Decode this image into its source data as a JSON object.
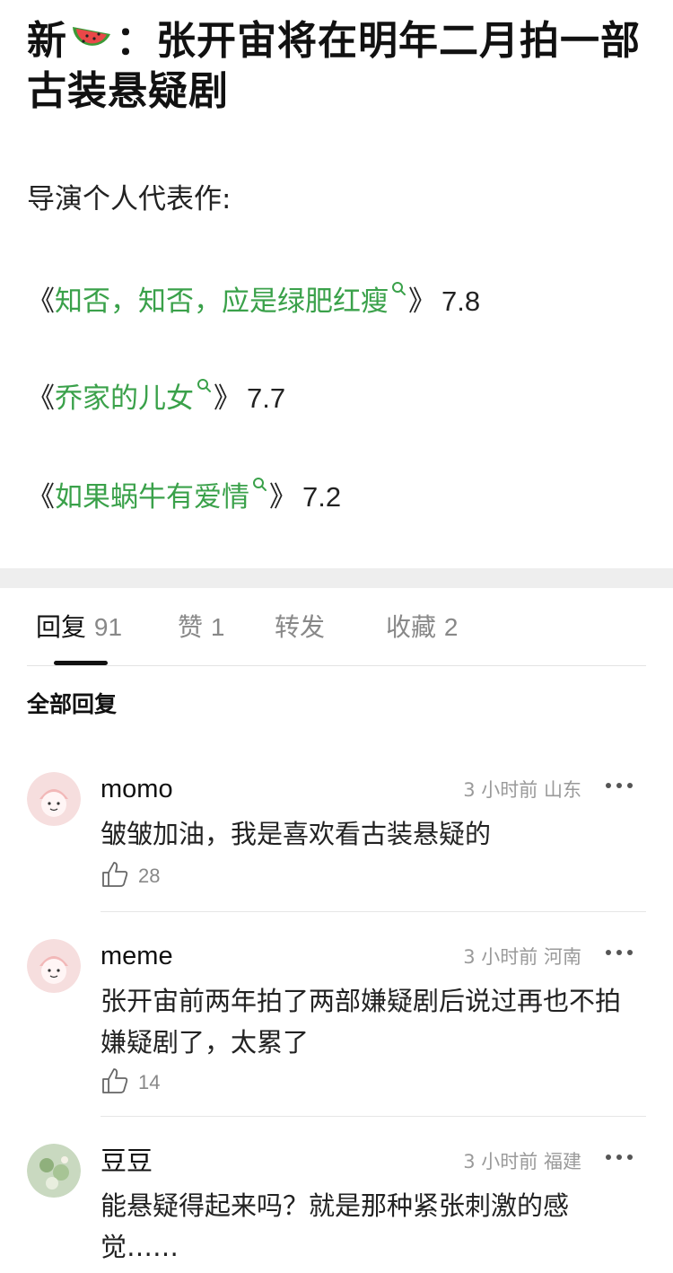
{
  "post": {
    "title_before": "新",
    "title_after": "：张开宙将在明年二月拍一部古装悬疑剧",
    "intro": "导演个人代表作:",
    "works": [
      {
        "open": "《",
        "name": "知否，知否，应是绿肥红瘦",
        "close": "》",
        "score": "7.8"
      },
      {
        "open": "《",
        "name": "乔家的儿女",
        "close": "》",
        "score": "7.7"
      },
      {
        "open": "《",
        "name": "如果蜗牛有爱情",
        "close": "》",
        "score": "7.2"
      }
    ]
  },
  "tabs": [
    {
      "label": "回复",
      "count": "91"
    },
    {
      "label": "赞",
      "count": "1"
    },
    {
      "label": "转发",
      "count": ""
    },
    {
      "label": "收藏",
      "count": "2"
    }
  ],
  "section_label": "全部回复",
  "comments": [
    {
      "user": "momo",
      "time": "3 小时前",
      "location": "山东",
      "text": "皱皱加油，我是喜欢看古装悬疑的",
      "likes": "28"
    },
    {
      "user": "meme",
      "time": "3 小时前",
      "location": "河南",
      "text": "张开宙前两年拍了两部嫌疑剧后说过再也不拍嫌疑剧了，太累了",
      "likes": "14"
    },
    {
      "user": "豆豆",
      "time": "3 小时前",
      "location": "福建",
      "text": "能悬疑得起来吗？就是那种紧张刺激的感觉……",
      "likes": ""
    }
  ],
  "colors": {
    "link_green": "#3aa14a",
    "divider_gray": "#eeeeee",
    "muted_text": "#9a9a9a"
  },
  "icons": [
    "watermelon-icon",
    "search-icon",
    "thumbs-up-icon",
    "more-options-icon",
    "avatar"
  ]
}
